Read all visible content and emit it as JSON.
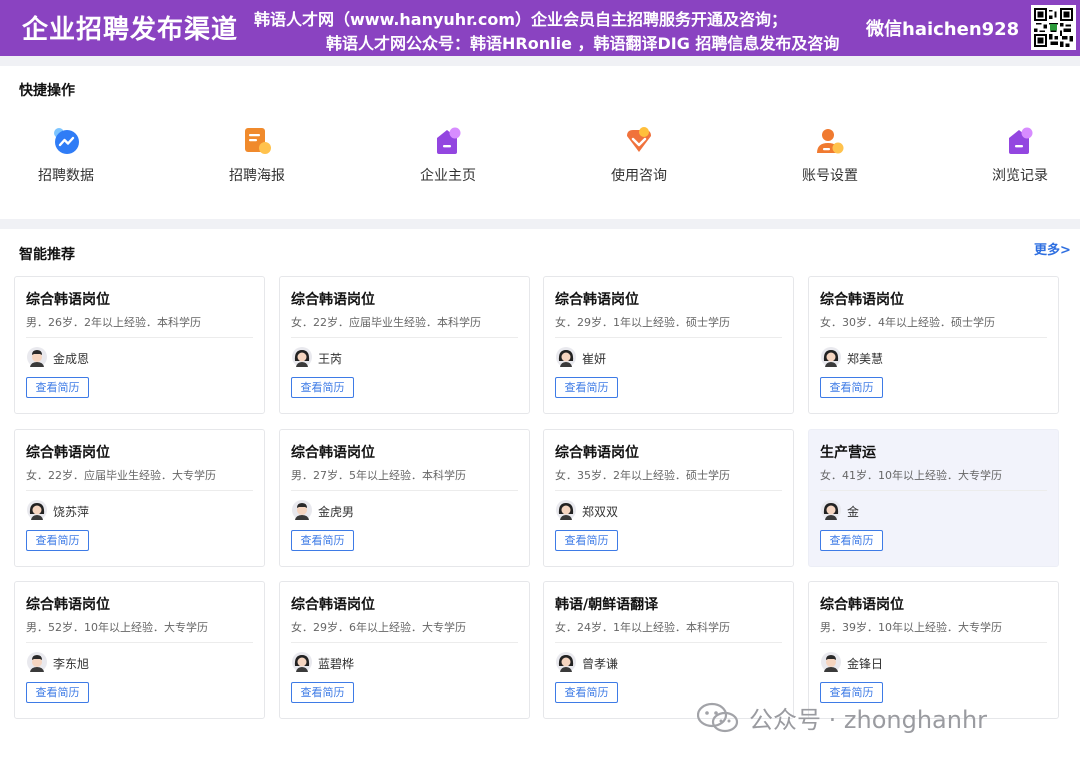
{
  "banner": {
    "brand": "企业招聘发布渠道",
    "line1": "韩语人才网（www.hanyuhr.com）企业会员自主招聘服务开通及咨询；",
    "line2": "韩语人才网公众号：韩语HRonlie ，韩语翻译DIG 招聘信息发布及咨询",
    "wechat": "微信haichen928"
  },
  "quick_actions": {
    "title": "快捷操作",
    "items": [
      {
        "label": "招聘数据",
        "icon": "messenger-chart-icon",
        "color": "#2f7cf6"
      },
      {
        "label": "招聘海报",
        "icon": "poster-icon",
        "color": "#f08a2c"
      },
      {
        "label": "企业主页",
        "icon": "house-icon",
        "color": "#9346e0"
      },
      {
        "label": "使用咨询",
        "icon": "heart-chat-icon",
        "color": "#f0723c"
      },
      {
        "label": "账号设置",
        "icon": "user-settings-icon",
        "color": "#f07a30"
      },
      {
        "label": "浏览记录",
        "icon": "history-icon",
        "color": "#9346e0"
      }
    ]
  },
  "recommend": {
    "title": "智能推荐",
    "more": "更多>",
    "view_resume": "查看简历",
    "cards": [
      {
        "job": "综合韩语岗位",
        "info": "男．26岁．2年以上经验．本科学历",
        "name": "金成恩"
      },
      {
        "job": "综合韩语岗位",
        "info": "女．22岁．应届毕业生经验．本科学历",
        "name": "王芮"
      },
      {
        "job": "综合韩语岗位",
        "info": "女．29岁．1年以上经验．硕士学历",
        "name": "崔妍"
      },
      {
        "job": "综合韩语岗位",
        "info": "女．30岁．4年以上经验．硕士学历",
        "name": "郑美慧"
      },
      {
        "job": "综合韩语岗位",
        "info": "女．22岁．应届毕业生经验．大专学历",
        "name": "饶苏萍"
      },
      {
        "job": "综合韩语岗位",
        "info": "男．27岁．5年以上经验．本科学历",
        "name": "金虎男"
      },
      {
        "job": "综合韩语岗位",
        "info": "女．35岁．2年以上经验．硕士学历",
        "name": "郑双双"
      },
      {
        "job": "生产营运",
        "info": "女．41岁．10年以上经验．大专学历",
        "name": "金"
      },
      {
        "job": "综合韩语岗位",
        "info": "男．52岁．10年以上经验．大专学历",
        "name": "李东旭"
      },
      {
        "job": "综合韩语岗位",
        "info": "女．29岁．6年以上经验．大专学历",
        "name": "蓝碧桦"
      },
      {
        "job": "韩语/朝鲜语翻译",
        "info": "女．24岁．1年以上经验．本科学历",
        "name": "曾孝谦"
      },
      {
        "job": "综合韩语岗位",
        "info": "男．39岁．10年以上经验．大专学历",
        "name": "金锋日"
      }
    ]
  },
  "watermark": {
    "text": "公众号 · zhonghanhr"
  },
  "colors": {
    "banner_bg": "#8a43c1",
    "accent_blue": "#3e7be6",
    "page_bg": "#f0f1f5"
  }
}
